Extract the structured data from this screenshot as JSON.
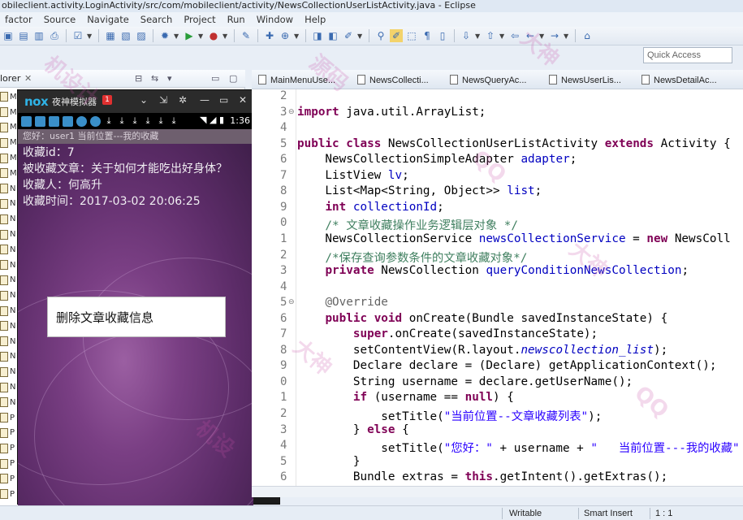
{
  "window": {
    "title": "obileclient.activity.LoginActivity/src/com/mobileclient/activity/NewsCollectionUserListActivity.java - Eclipse"
  },
  "menu": [
    "factor",
    "Source",
    "Navigate",
    "Search",
    "Project",
    "Run",
    "Window",
    "Help"
  ],
  "quick_access": {
    "placeholder": "Quick Access"
  },
  "explorer": {
    "tab_label": "lorer",
    "row_letters": [
      "M",
      "M",
      "M",
      "M",
      "M",
      "M",
      "N",
      "N",
      "N",
      "N",
      "N",
      "N",
      "N",
      "N",
      "N",
      "N",
      "N",
      "N",
      "N",
      "N",
      "N",
      "P",
      "P",
      "P",
      "P",
      "P",
      "P"
    ]
  },
  "emulator": {
    "logo": "nox",
    "title": "夜神模拟器",
    "badge": "1",
    "time": "1:36",
    "app_bar_text": "您好：user1  当前位置---我的收藏",
    "info": {
      "collection_id": "收藏id：7",
      "article": "被收藏文章：关于如何才能吃出好身体？",
      "collector": "收藏人：何高升",
      "time": "收藏时间：2017-03-02 20:06:25"
    },
    "delete_button": "删除文章收藏信息"
  },
  "editor_tabs": [
    "MainMenuUse...",
    "NewsCollecti...",
    "NewsQueryAc...",
    "NewsUserLis...",
    "NewsDetailAc..."
  ],
  "code": {
    "line_numbers": [
      "2",
      "3",
      "4",
      "5",
      "6",
      "7",
      "8",
      "9",
      "0",
      "1",
      "2",
      "3",
      "4",
      "5",
      "6",
      "7",
      "8",
      "9",
      "0",
      "1",
      "2",
      "3",
      "4",
      "5",
      "6"
    ],
    "lines": [
      {
        "segs": [
          {
            "t": ""
          }
        ]
      },
      {
        "segs": [
          {
            "t": "import",
            "c": "kw"
          },
          {
            "t": " java.util.ArrayList;"
          }
        ]
      },
      {
        "segs": [
          {
            "t": ""
          }
        ]
      },
      {
        "segs": [
          {
            "t": "public",
            "c": "kw"
          },
          {
            "t": " "
          },
          {
            "t": "class",
            "c": "kw"
          },
          {
            "t": " NewsCollectionUserListActivity "
          },
          {
            "t": "extends",
            "c": "kw"
          },
          {
            "t": " Activity {"
          }
        ]
      },
      {
        "segs": [
          {
            "t": "    NewsCollectionSimpleAdapter "
          },
          {
            "t": "adapter",
            "c": "fld"
          },
          {
            "t": ";"
          }
        ]
      },
      {
        "segs": [
          {
            "t": "    ListView "
          },
          {
            "t": "lv",
            "c": "fld"
          },
          {
            "t": ";"
          }
        ]
      },
      {
        "segs": [
          {
            "t": "    List<Map<String, Object>> "
          },
          {
            "t": "list",
            "c": "fld"
          },
          {
            "t": ";"
          }
        ]
      },
      {
        "segs": [
          {
            "t": "    "
          },
          {
            "t": "int",
            "c": "kw"
          },
          {
            "t": " "
          },
          {
            "t": "collectionId",
            "c": "fld"
          },
          {
            "t": ";"
          }
        ]
      },
      {
        "segs": [
          {
            "t": "    /* 文章收藏操作业务逻辑层对象 */",
            "c": "cm"
          }
        ]
      },
      {
        "segs": [
          {
            "t": "    NewsCollectionService "
          },
          {
            "t": "newsCollectionService",
            "c": "fld"
          },
          {
            "t": " = "
          },
          {
            "t": "new",
            "c": "kw"
          },
          {
            "t": " NewsColl"
          }
        ]
      },
      {
        "segs": [
          {
            "t": "    /*保存查询参数条件的文章收藏对象*/",
            "c": "cm"
          }
        ]
      },
      {
        "segs": [
          {
            "t": "    "
          },
          {
            "t": "private",
            "c": "kw"
          },
          {
            "t": " NewsCollection "
          },
          {
            "t": "queryConditionNewsCollection",
            "c": "fld"
          },
          {
            "t": ";"
          }
        ]
      },
      {
        "segs": [
          {
            "t": ""
          }
        ]
      },
      {
        "segs": [
          {
            "t": "    "
          },
          {
            "t": "@Override",
            "c": "ann"
          }
        ]
      },
      {
        "segs": [
          {
            "t": "    "
          },
          {
            "t": "public",
            "c": "kw"
          },
          {
            "t": " "
          },
          {
            "t": "void",
            "c": "kw"
          },
          {
            "t": " onCreate(Bundle savedInstanceState) {"
          }
        ]
      },
      {
        "segs": [
          {
            "t": "        "
          },
          {
            "t": "super",
            "c": "kw"
          },
          {
            "t": ".onCreate(savedInstanceState);"
          }
        ]
      },
      {
        "segs": [
          {
            "t": "        setContentView(R.layout."
          },
          {
            "t": "newscollection_list",
            "c": "sfld"
          },
          {
            "t": ");"
          }
        ]
      },
      {
        "segs": [
          {
            "t": "        Declare declare = (Declare) getApplicationContext();"
          }
        ]
      },
      {
        "segs": [
          {
            "t": "        String username = declare.getUserName();"
          }
        ]
      },
      {
        "segs": [
          {
            "t": "        "
          },
          {
            "t": "if",
            "c": "kw"
          },
          {
            "t": " (username == "
          },
          {
            "t": "null",
            "c": "kw"
          },
          {
            "t": ") {"
          }
        ]
      },
      {
        "segs": [
          {
            "t": "            setTitle("
          },
          {
            "t": "\"当前位置--文章收藏列表\"",
            "c": "str"
          },
          {
            "t": ");"
          }
        ]
      },
      {
        "segs": [
          {
            "t": "        } "
          },
          {
            "t": "else",
            "c": "kw"
          },
          {
            "t": " {"
          }
        ]
      },
      {
        "segs": [
          {
            "t": "            setTitle("
          },
          {
            "t": "\"您好：\"",
            "c": "str"
          },
          {
            "t": " + username + "
          },
          {
            "t": "\"   当前位置---我的收藏\"",
            "c": "str"
          }
        ]
      },
      {
        "segs": [
          {
            "t": "        }"
          }
        ]
      },
      {
        "segs": [
          {
            "t": "        Bundle extras = "
          },
          {
            "t": "this",
            "c": "kw"
          },
          {
            "t": ".getIntent().getExtras();"
          }
        ]
      }
    ]
  },
  "status": {
    "writable": "Writable",
    "insert_mode": "Smart Insert",
    "position": "1 : 1"
  }
}
